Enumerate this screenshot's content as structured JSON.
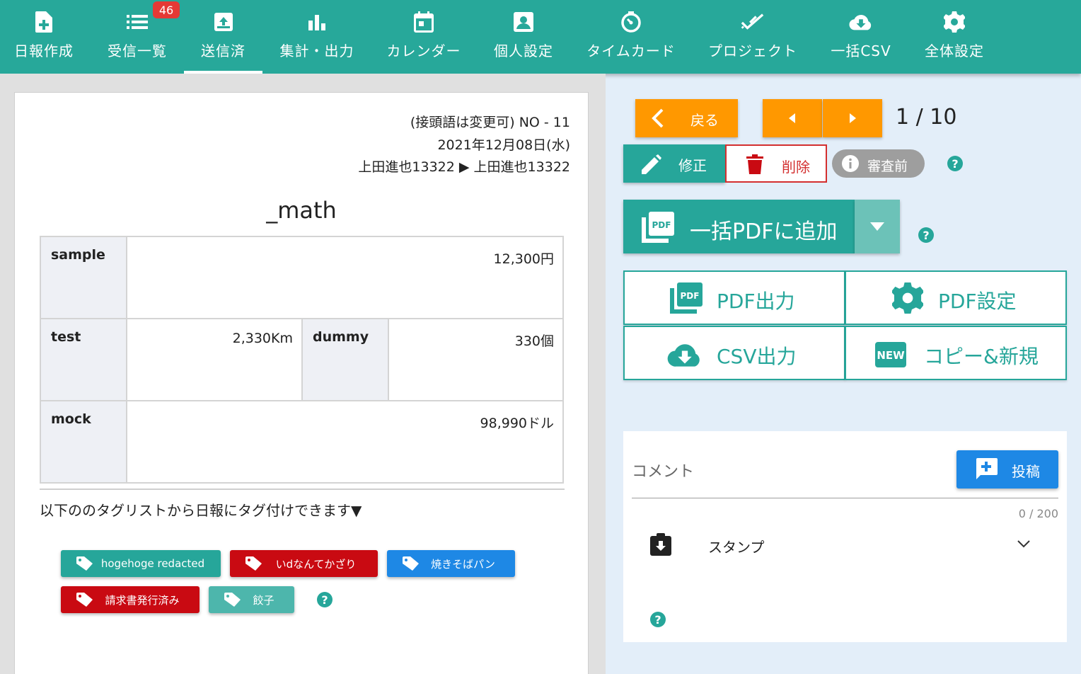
{
  "nav": {
    "items": [
      {
        "label": "日報作成",
        "icon": "file-plus-icon"
      },
      {
        "label": "受信一覧",
        "icon": "list-icon",
        "badge": "46"
      },
      {
        "label": "送信済",
        "icon": "outbox-icon",
        "active": true
      },
      {
        "label": "集計・出力",
        "icon": "bar-chart-icon"
      },
      {
        "label": "カレンダー",
        "icon": "calendar-icon"
      },
      {
        "label": "個人設定",
        "icon": "person-card-icon"
      },
      {
        "label": "タイムカード",
        "icon": "timer-icon"
      },
      {
        "label": "プロジェクト",
        "icon": "double-check-icon"
      },
      {
        "label": "一括CSV",
        "icon": "cloud-download-icon"
      },
      {
        "label": "全体設定",
        "icon": "gear-icon"
      }
    ]
  },
  "report": {
    "number": "(接頭語は変更可) NO - 11",
    "date": "2021年12月08日(水)",
    "route": "上田進也13322 ▶ 上田進也13322",
    "title": "_math",
    "rows": {
      "sample": {
        "label": "sample",
        "value": "12,300円"
      },
      "test": {
        "label": "test",
        "value": "2,330Km"
      },
      "dummy": {
        "label": "dummy",
        "value": "330個"
      },
      "mock": {
        "label": "mock",
        "value": "98,990ドル"
      }
    },
    "tag_intro": "以下ののタグリストから日報にタグ付けできます▼",
    "tags": [
      {
        "label": "hogehoge redacted",
        "color": "#26a69a"
      },
      {
        "label": "いdなんてかざり",
        "color": "#c90a12"
      },
      {
        "label": "焼きそばパン",
        "color": "#1e88e5"
      },
      {
        "label": "請求書発行済み",
        "color": "#c90a12"
      },
      {
        "label": "餃子",
        "color": "#4db6ac"
      }
    ],
    "help": "?"
  },
  "actions": {
    "back_label": "戻る",
    "pager": "1 / 10",
    "edit_label": "修正",
    "delete_label": "削除",
    "review_label": "審査前",
    "bulk_pdf_label": "一括PDFに追加",
    "pdf_output_label": "PDF出力",
    "pdf_settings_label": "PDF設定",
    "csv_output_label": "CSV出力",
    "copy_new_label": "コピー&新規",
    "help": "?"
  },
  "comment": {
    "label": "コメント",
    "post_label": "投稿",
    "counter": "0 / 200",
    "stamp_label": "スタンプ",
    "help": "?"
  },
  "colors": {
    "primary": "#26a69a",
    "nav": "#27a89a",
    "orange": "#ff9800",
    "danger": "#d32f2f",
    "blue": "#1e88e5"
  }
}
